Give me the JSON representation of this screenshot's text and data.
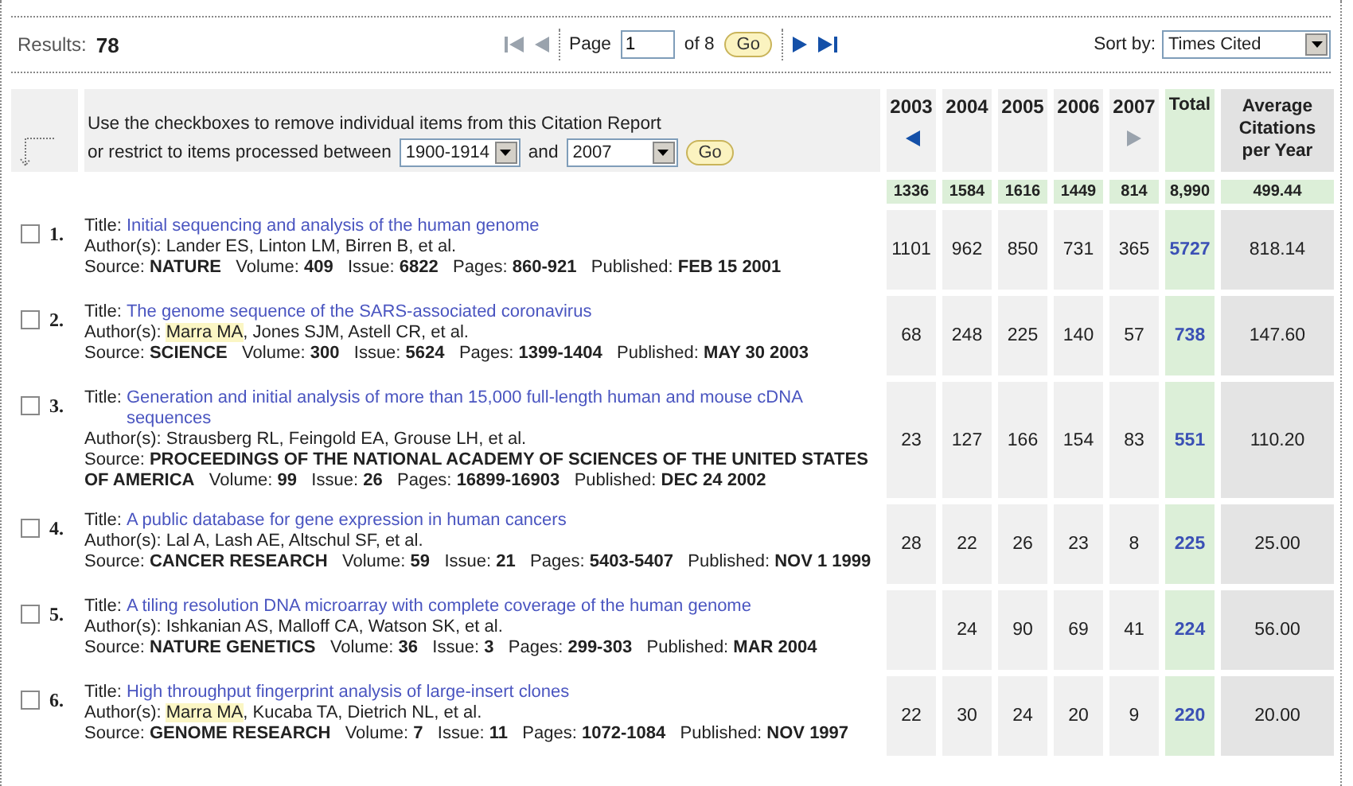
{
  "results": {
    "label": "Results:",
    "count": "78"
  },
  "pager": {
    "first_enabled": false,
    "prev_enabled": false,
    "next_enabled": true,
    "last_enabled": true,
    "page_label": "Page",
    "page_value": "1",
    "of_label": "of 8",
    "go": "Go"
  },
  "sort": {
    "label": "Sort by:",
    "value": "Times Cited"
  },
  "filter": {
    "line1": "Use the checkboxes to remove individual items from this Citation Report",
    "line2": "or restrict to items processed between",
    "from": "1900-1914",
    "and": "and",
    "to": "2007",
    "go": "Go"
  },
  "columns": [
    "2003",
    "2004",
    "2005",
    "2006",
    "2007"
  ],
  "year_nav": {
    "previous_enabled": true,
    "next_enabled": false
  },
  "total_label": "Total",
  "average_label": "Average Citations per Year",
  "totals": {
    "years": [
      "1336",
      "1584",
      "1616",
      "1449",
      "814"
    ],
    "total": "8,990",
    "average": "499.44"
  },
  "records": [
    {
      "number": "1.",
      "checked": false,
      "title_label": "Title:",
      "title": "Initial sequencing and analysis of the human genome",
      "authors_label": "Author(s):",
      "authors": [
        {
          "text": "Lander ES, Linton LM, Birren B, et al.",
          "highlighted": false
        }
      ],
      "source": "Source: **NATURE**   Volume: **409**   Issue: **6822**   Pages: **860-921**   Published: **FEB 15 2001**",
      "years": [
        "1101",
        "962",
        "850",
        "731",
        "365"
      ],
      "total": "5727",
      "average": "818.14"
    },
    {
      "number": "2.",
      "checked": false,
      "title_label": "Title:",
      "title": "The genome sequence of the SARS-associated coronavirus",
      "authors_label": "Author(s):",
      "authors": [
        {
          "text": "Marra MA",
          "highlighted": true
        },
        {
          "text": ", Jones SJM, Astell CR, et al.",
          "highlighted": false
        }
      ],
      "source": "Source: **SCIENCE**   Volume: **300**   Issue: **5624**   Pages: **1399-1404**   Published: **MAY 30 2003**",
      "years": [
        "68",
        "248",
        "225",
        "140",
        "57"
      ],
      "total": "738",
      "average": "147.60"
    },
    {
      "number": "3.",
      "checked": false,
      "title_label": "Title:",
      "title": "Generation and initial analysis of more than 15,000 full-length human and mouse cDNA sequences",
      "authors_label": "Author(s):",
      "authors": [
        {
          "text": "Strausberg RL, Feingold EA, Grouse LH, et al.",
          "highlighted": false
        }
      ],
      "source": "Source: **PROCEEDINGS OF THE NATIONAL ACADEMY OF SCIENCES OF THE UNITED STATES OF AMERICA**   Volume: **99**   Issue: **26**   Pages: **16899-16903**   Published: **DEC 24 2002**",
      "years": [
        "23",
        "127",
        "166",
        "154",
        "83"
      ],
      "total": "551",
      "average": "110.20"
    },
    {
      "number": "4.",
      "checked": false,
      "title_label": "Title:",
      "title": "A public database for gene expression in human cancers",
      "authors_label": "Author(s):",
      "authors": [
        {
          "text": "Lal A, Lash AE, Altschul SF, et al.",
          "highlighted": false
        }
      ],
      "source": "Source: **CANCER RESEARCH**   Volume: **59**   Issue: **21**   Pages: **5403-5407**   Published: **NOV 1 1999**",
      "years": [
        "28",
        "22",
        "26",
        "23",
        "8"
      ],
      "total": "225",
      "average": "25.00"
    },
    {
      "number": "5.",
      "checked": false,
      "title_label": "Title:",
      "title": "A tiling resolution DNA microarray with complete coverage of the human genome",
      "authors_label": "Author(s):",
      "authors": [
        {
          "text": "Ishkanian AS, Malloff CA, Watson SK, et al.",
          "highlighted": false
        }
      ],
      "source": "Source: **NATURE GENETICS**   Volume: **36**   Issue: **3**   Pages: **299-303**   Published: **MAR 2004**",
      "years": [
        {
          "kind": "blank"
        },
        "24",
        "90",
        "69",
        "41"
      ],
      "total": "224",
      "average": "56.00"
    },
    {
      "number": "6.",
      "checked": false,
      "title_label": "Title:",
      "title": "High throughput fingerprint analysis of large-insert clones",
      "authors_label": "Author(s):",
      "authors": [
        {
          "text": "Marra MA",
          "highlighted": true
        },
        {
          "text": ", Kucaba TA, Dietrich NL, et al.",
          "highlighted": false
        }
      ],
      "source": "Source: **GENOME RESEARCH**   Volume: **7**   Issue: **11**   Pages: **1072-1084**   Published: **NOV 1997**",
      "years": [
        "22",
        "30",
        "24",
        "20",
        "9"
      ],
      "total": "220",
      "average": "20.00"
    }
  ]
}
